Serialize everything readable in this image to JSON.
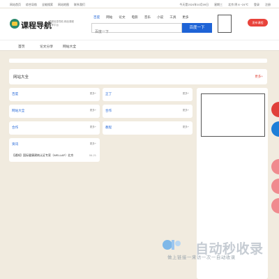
{
  "topbar": {
    "links": [
      "网站首页",
      "综合导航",
      "全能搜索",
      "网站地图",
      "联系我们"
    ],
    "date": "今天是2024年10月09日",
    "weekday": "星期三",
    "weather": "北京 阴 8 ~24℃",
    "login": "登录",
    "register": "注册"
  },
  "header": {
    "brand": "课程导航",
    "brand_sub": "课程信息导航 精品课程分享平台",
    "search_tabs": [
      "百度",
      "网站",
      "论文",
      "电影",
      "音乐",
      "小说",
      "工具",
      "更多"
    ],
    "search_placeholder": "百度一下",
    "search_button": "百度一下",
    "cta": "发布课程"
  },
  "nav": [
    "首页",
    "论文分享",
    "网站大全"
  ],
  "section": {
    "title": "网站大全",
    "more": "更多+"
  },
  "cards": {
    "baidu": {
      "title": "百度",
      "more": "更多+"
    },
    "guangong": {
      "title": "正丁",
      "more": "更多+"
    },
    "wangzhan": {
      "title": "网站大全",
      "more": "更多+"
    },
    "hezuo": {
      "title": "合作",
      "more": "更多+"
    },
    "hezuo2": {
      "title": "合作",
      "more": "更多+"
    },
    "jiaocheng": {
      "title": "教程",
      "more": "更多+"
    },
    "zixun": {
      "title": "资讯",
      "more": "更多+"
    }
  },
  "news": [
    {
      "title": "【通知】国际健康建筑认证专家（WELLAP）北京",
      "date": "06-21"
    }
  ],
  "watermark": {
    "text": "自动秒收录",
    "sub": "做上链接一来访一次一自动收录"
  },
  "colors": {
    "page_bg": "#f1ebdf",
    "accent": "#1e63d6",
    "cta": "#e8433b",
    "float_red": "#e0403a",
    "float_blue": "#1e7ed8",
    "float_pink": "#f08a8e"
  }
}
